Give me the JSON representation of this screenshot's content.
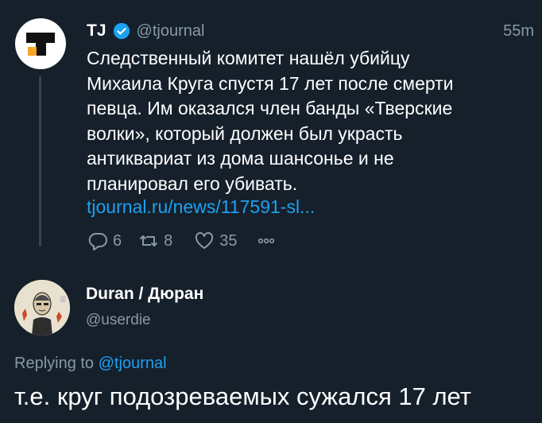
{
  "tweet": {
    "author_name": "TJ",
    "author_handle": "@tjournal",
    "time": "55m",
    "text": "Следственный комитет нашёл убийцу\nМихаила Круга спустя 17 лет после смерти\nпевца. Им оказался член банды «Тверские\nволки», который должен был украсть\nантиквариат из дома шансонье и не\nпланировал его убивать.",
    "link": "tjournal.ru/news/117591-sl...",
    "replies": "6",
    "retweets": "8",
    "likes": "35",
    "icons": {
      "verified": "verified-badge-icon",
      "reply": "reply-icon",
      "retweet": "retweet-icon",
      "like": "heart-icon",
      "more": "more-icon"
    }
  },
  "reply": {
    "author_name": "Duran / Дюран",
    "author_handle": "@userdie",
    "replying_prefix": "Replying to",
    "replying_to": "@tjournal",
    "text": "т.е. круг подозреваемых сужался 17 лет"
  },
  "colors": {
    "background": "#15202b",
    "accent": "#1da1f2",
    "secondary_text": "#8899a6",
    "thread_line": "#38444d"
  }
}
